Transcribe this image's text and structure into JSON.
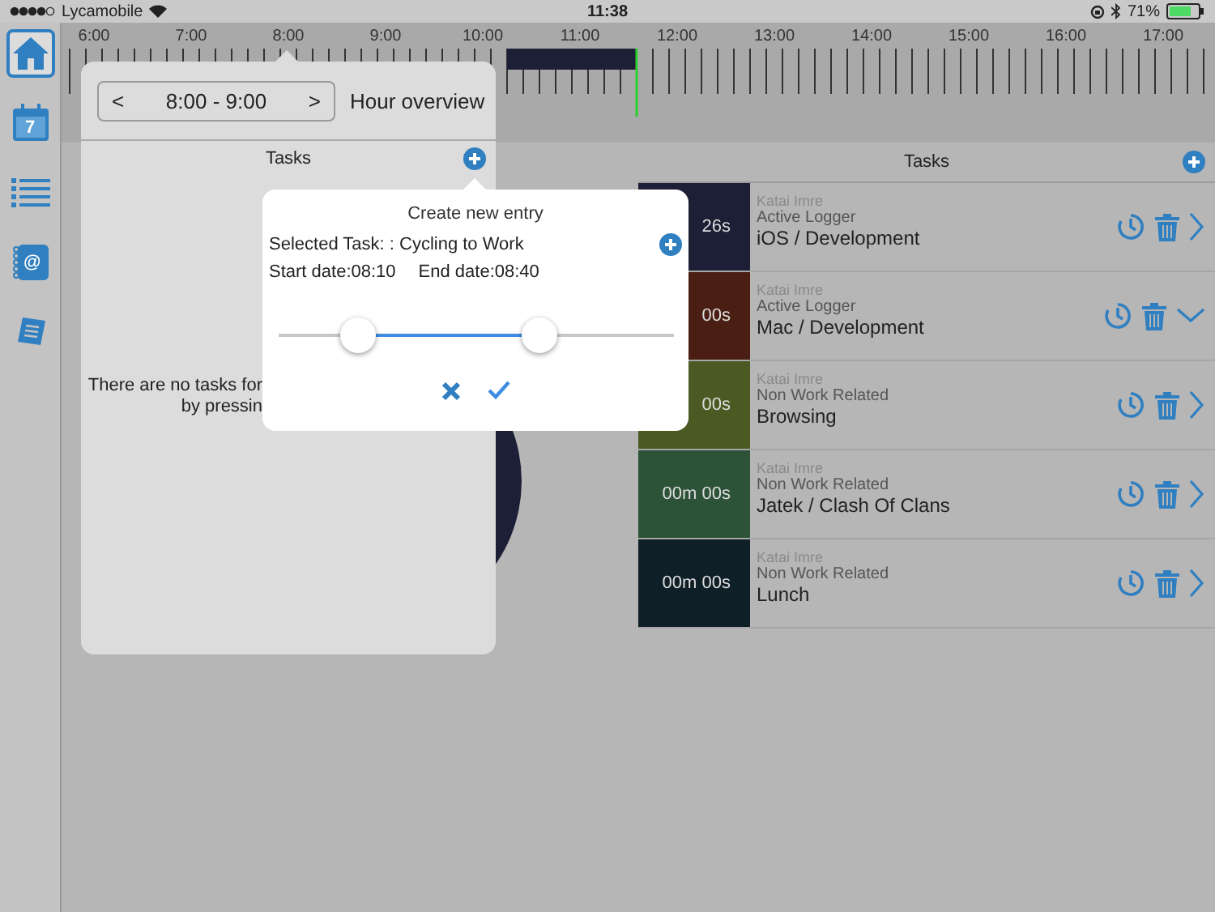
{
  "status_bar": {
    "carrier": "Lycamobile",
    "time": "11:38",
    "battery": "71%"
  },
  "sidebar": {
    "items": [
      {
        "kind": "home",
        "selected": true
      },
      {
        "kind": "calendar",
        "text": "7",
        "selected": false
      },
      {
        "kind": "list",
        "selected": false
      },
      {
        "kind": "contacts",
        "text": "@",
        "selected": false
      },
      {
        "kind": "notes",
        "selected": false
      }
    ]
  },
  "timeline": {
    "hours": [
      "6:00",
      "7:00",
      "8:00",
      "9:00",
      "10:00",
      "11:00",
      "12:00",
      "13:00",
      "14:00",
      "15:00",
      "16:00",
      "17:00"
    ]
  },
  "tasks": {
    "title": "Tasks",
    "rows": [
      {
        "duration": "26s",
        "color": "#1c1f35",
        "owner": "Katai Imre",
        "category": "Active Logger",
        "name": "iOS / Development",
        "expanded": false
      },
      {
        "duration": "00s",
        "color": "#4a1e12",
        "owner": "Katai Imre",
        "category": "Active Logger",
        "name": "Mac / Development",
        "expanded": true
      },
      {
        "duration": "00s",
        "color": "#4b5a22",
        "owner": "Katai Imre",
        "category": "Non Work Related",
        "name": "Browsing",
        "expanded": false
      },
      {
        "duration": "00m 00s",
        "color": "#2c5238",
        "owner": "Katai Imre",
        "category": "Non Work Related",
        "name": "Jatek / Clash Of Clans",
        "expanded": false
      },
      {
        "duration": "00m 00s",
        "color": "#0f1f27",
        "owner": "Katai Imre",
        "category": "Non Work Related",
        "name": "Lunch",
        "expanded": false
      }
    ]
  },
  "hour_overview": {
    "prev": "<",
    "range": "8:00 - 9:00",
    "next": ">",
    "title": "Hour overview",
    "tasks_title": "Tasks",
    "message_lines": [
      "There are no tasks for",
      "by pressin"
    ]
  },
  "new_entry": {
    "title": "Create new entry",
    "selected_task": "Selected Task: : Cycling to Work",
    "start": "Start date:08:10",
    "end": "End date:08:40",
    "slider": {
      "thumbs": [
        {
          "level": 0.2
        },
        {
          "level": 0.66
        }
      ]
    }
  }
}
